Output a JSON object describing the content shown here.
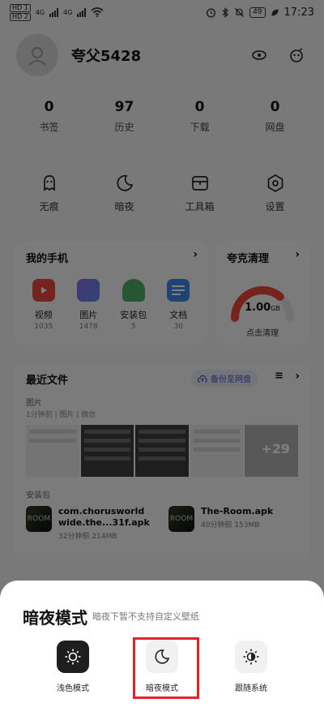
{
  "status_bar": {
    "sim1": "HD 1",
    "sim2": "HD 2",
    "net1": "4G",
    "net2": "4G",
    "battery": "49",
    "time": "17:23"
  },
  "profile": {
    "username": "夸父5428",
    "icons": [
      "eye-icon",
      "mascot-icon"
    ]
  },
  "stats": [
    {
      "value": "0",
      "label": "书签"
    },
    {
      "value": "97",
      "label": "历史"
    },
    {
      "value": "0",
      "label": "下载"
    },
    {
      "value": "0",
      "label": "网盘"
    }
  ],
  "tools": [
    {
      "label": "无痕",
      "icon": "incognito-icon"
    },
    {
      "label": "暗夜",
      "icon": "moon-icon"
    },
    {
      "label": "工具箱",
      "icon": "toolbox-icon"
    },
    {
      "label": "设置",
      "icon": "settings-icon"
    }
  ],
  "my_phone": {
    "title": "我的手机",
    "arrow": "›",
    "apps": [
      {
        "name": "视频",
        "count": "1035",
        "color": "#e8473d"
      },
      {
        "name": "图片",
        "count": "1478",
        "color": "#6b7be8"
      },
      {
        "name": "安装包",
        "count": "5",
        "color": "#4cae64"
      },
      {
        "name": "文档",
        "count": "30",
        "color": "#3f86e8"
      }
    ]
  },
  "cleaner": {
    "title": "夸克清理",
    "arrow": "›",
    "value": "1.00",
    "unit": "GB",
    "action": "点击清理",
    "fill_fraction": 0.72,
    "color": "#e8473d"
  },
  "recent": {
    "title": "最近文件",
    "backup_label": "备份至网盘",
    "sort_glyph": "≡",
    "arrow": "›",
    "images_label": "图片",
    "images_sub": "1分钟前 | 图片 | 微信",
    "more_count": "+29",
    "packages_label": "安装包",
    "files": [
      {
        "name": "com.chorusworld wide.the...31f.apk",
        "info": "32分钟前  214MB",
        "thumb": "ROOM"
      },
      {
        "name": "The-Room.apk",
        "info": "40分钟前  153MB",
        "thumb": "ROOM"
      }
    ]
  },
  "sheet": {
    "title": "暗夜模式",
    "subtitle": "暗夜下暂不支持自定义壁纸",
    "modes": [
      {
        "label": "浅色模式",
        "icon": "sun-icon",
        "style": "dark"
      },
      {
        "label": "暗夜模式",
        "icon": "moon-icon",
        "style": "light"
      },
      {
        "label": "跟随系统",
        "icon": "half-sun-icon",
        "style": "light"
      }
    ],
    "highlight_color": "#e0242a"
  }
}
